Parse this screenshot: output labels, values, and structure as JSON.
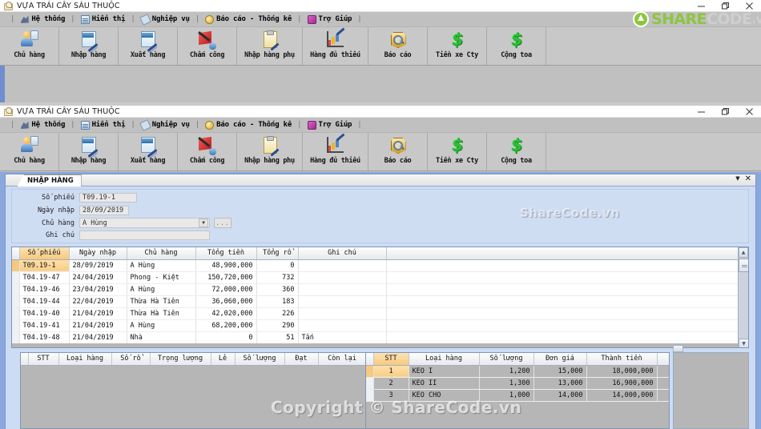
{
  "window_top": {
    "title": "VỰA TRÁI CÂY SÁU THUỘC",
    "icon": "app-icon",
    "controls": {
      "minimize": "minimize-icon",
      "maximize": "maximize-icon",
      "close": "close-icon"
    },
    "menu": [
      {
        "label": "Hệ thống",
        "icon": "system-icon"
      },
      {
        "label": "Hiển thị",
        "icon": "display-icon"
      },
      {
        "label": "Nghiệp vụ",
        "icon": "operations-icon"
      },
      {
        "label": "Báo cáo - Thống kê",
        "icon": "report-icon"
      },
      {
        "label": "Trợ Giúp",
        "icon": "help-icon"
      }
    ],
    "toolbar": [
      {
        "label": "Chủ hàng",
        "icon": "owner-icon"
      },
      {
        "label": "Nhập hàng",
        "icon": "import-icon"
      },
      {
        "label": "Xuất hàng",
        "icon": "export-icon"
      },
      {
        "label": "Chấm công",
        "icon": "timesheet-icon"
      },
      {
        "label": "Nhập hàng phụ",
        "icon": "sub-import-icon"
      },
      {
        "label": "Hàng đủ thiếu",
        "icon": "stock-check-icon"
      },
      {
        "label": "Báo cáo",
        "icon": "report-search-icon"
      },
      {
        "label": "Tiền xe Cty",
        "icon": "money-icon"
      },
      {
        "label": "Cộng toa",
        "icon": "money-icon"
      }
    ],
    "logo": {
      "part1": "SHARE",
      "part2": "CODE",
      "part3": ".vn"
    }
  },
  "window_main": {
    "title": "VỰA TRÁI CÂY SÁU THUỘC",
    "icon": "app-icon",
    "controls": {
      "minimize": "minimize-icon",
      "maximize": "maximize-icon",
      "close": "close-icon"
    },
    "menu": [
      {
        "label": "Hệ thống",
        "icon": "system-icon"
      },
      {
        "label": "Hiển thị",
        "icon": "display-icon"
      },
      {
        "label": "Nghiệp vụ",
        "icon": "operations-icon"
      },
      {
        "label": "Báo cáo - Thống kê",
        "icon": "report-icon"
      },
      {
        "label": "Trợ Giúp",
        "icon": "help-icon"
      }
    ],
    "toolbar": [
      {
        "label": "Chủ hàng",
        "icon": "owner-icon"
      },
      {
        "label": "Nhập hàng",
        "icon": "import-icon"
      },
      {
        "label": "Xuất hàng",
        "icon": "export-icon"
      },
      {
        "label": "Chấm công",
        "icon": "timesheet-icon"
      },
      {
        "label": "Nhập hàng phụ",
        "icon": "sub-import-icon"
      },
      {
        "label": "Hàng đủ thiếu",
        "icon": "stock-check-icon"
      },
      {
        "label": "Báo cáo",
        "icon": "report-search-icon"
      },
      {
        "label": "Tiền xe Cty",
        "icon": "money-icon"
      },
      {
        "label": "Cộng toa",
        "icon": "money-icon"
      }
    ]
  },
  "child_form": {
    "tab_label": "NHẬP HÀNG",
    "tab_dropdown_icon": "chevron-down-icon",
    "tab_close_icon": "close-icon",
    "fields": {
      "so_phieu": {
        "label": "Số phiếu",
        "value": "T09.19-1"
      },
      "ngay_nhap": {
        "label": "Ngày nhập",
        "value": "28/09/2019"
      },
      "chu_hang": {
        "label": "Chủ hàng",
        "value": "A Hùng",
        "dropdown_icon": "chevron-down-icon",
        "browse_label": "..."
      },
      "ghi_chu": {
        "label": "Ghi chú",
        "value": ""
      }
    },
    "watermark": "ShareCode.vn"
  },
  "grid_main": {
    "columns": [
      "Số phiếu",
      "Ngày nhập",
      "Chủ hàng",
      "Tổng tiền",
      "Tổng rổ",
      "Ghi chú"
    ],
    "rows": [
      {
        "so_phieu": "T09.19-1",
        "ngay_nhap": "28/09/2019",
        "chu_hang": "A Hùng",
        "tong_tien": "48,900,000",
        "tong_ro": "0",
        "ghi_chu": "",
        "selected": true
      },
      {
        "so_phieu": "T04.19-47",
        "ngay_nhap": "24/04/2019",
        "chu_hang": "Phong - Kiệt",
        "tong_tien": "150,720,000",
        "tong_ro": "732",
        "ghi_chu": "",
        "selected": false
      },
      {
        "so_phieu": "T04.19-46",
        "ngay_nhap": "23/04/2019",
        "chu_hang": "A Hùng",
        "tong_tien": "72,000,000",
        "tong_ro": "360",
        "ghi_chu": "",
        "selected": false
      },
      {
        "so_phieu": "T04.19-44",
        "ngay_nhap": "22/04/2019",
        "chu_hang": "Thừa Hà Tiên",
        "tong_tien": "36,060,000",
        "tong_ro": "183",
        "ghi_chu": "",
        "selected": false
      },
      {
        "so_phieu": "T04.19-40",
        "ngay_nhap": "21/04/2019",
        "chu_hang": "Thừa Hà Tiên",
        "tong_tien": "42,020,000",
        "tong_ro": "226",
        "ghi_chu": "",
        "selected": false
      },
      {
        "so_phieu": "T04.19-41",
        "ngay_nhap": "21/04/2019",
        "chu_hang": "A Hùng",
        "tong_tien": "68,200,000",
        "tong_ro": "290",
        "ghi_chu": "",
        "selected": false
      },
      {
        "so_phieu": "T04.19-48",
        "ngay_nhap": "21/04/2019",
        "chu_hang": "Nhà",
        "tong_tien": "0",
        "tong_ro": "51",
        "ghi_chu": "Tấn",
        "selected": false
      }
    ]
  },
  "grid_left": {
    "columns": [
      "STT",
      "Loại hàng",
      "Số rổ",
      "Trọng lượng",
      "Lẻ",
      "Số lượng",
      "Đạt",
      "Còn lại"
    ],
    "rows": []
  },
  "grid_right": {
    "columns": [
      "STT",
      "Loại hàng",
      "Số lượng",
      "Đơn giá",
      "Thành tiền"
    ],
    "rows": [
      {
        "stt": "1",
        "loai_hang": "KEO I",
        "so_luong": "1,200",
        "don_gia": "15,000",
        "thanh_tien": "18,000,000",
        "selected": true
      },
      {
        "stt": "2",
        "loai_hang": "KEO II",
        "so_luong": "1,300",
        "don_gia": "13,000",
        "thanh_tien": "16,900,000",
        "selected": false
      },
      {
        "stt": "3",
        "loai_hang": "KEO CHO",
        "so_luong": "1,000",
        "don_gia": "14,000",
        "thanh_tien": "14,000,000",
        "selected": false
      }
    ]
  },
  "watermarks": {
    "bottom": "Copyright © ShareCode.vn"
  },
  "colors": {
    "mdi_background": "#8aa8dd",
    "form_panel": "#cfddf3",
    "toolbar": "#c8c8c8",
    "selection": "#f6c97e",
    "brand_green": "#8cc63f",
    "brand_gray": "#cfcfcf"
  }
}
